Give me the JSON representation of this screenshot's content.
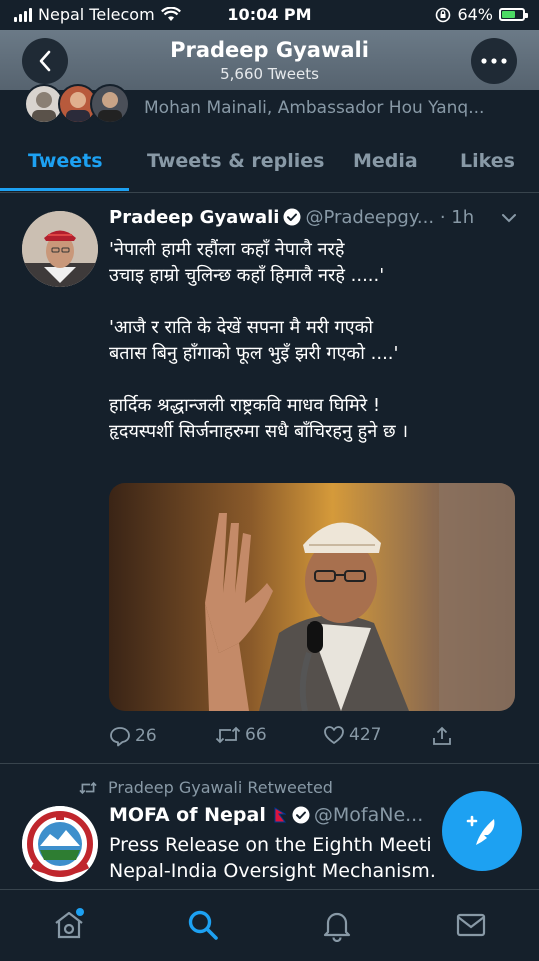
{
  "status_bar": {
    "carrier": "Nepal Telecom",
    "time": "10:04 PM",
    "battery": "64%",
    "battery_level": 0.64
  },
  "header": {
    "name": "Pradeep Gyawali",
    "tweet_count": "5,660 Tweets"
  },
  "followers_preview": {
    "text": "Mohan Mainali, Ambassador Hou Yanq..."
  },
  "tabs": [
    {
      "label": "Tweets",
      "active": true
    },
    {
      "label": "Tweets & replies",
      "active": false
    },
    {
      "label": "Media",
      "active": false
    },
    {
      "label": "Likes",
      "active": false
    }
  ],
  "tweet": {
    "name": "Pradeep Gyawali",
    "handle": "@Pradeepgy...",
    "time": "· 1h",
    "body": [
      "'नेपाली हामी रहौंला कहाँ नेपालै नरहे\nउचाइ हाम्रो चुलिन्छ कहाँ हिमालै नरहे .....'",
      "'आजै र राति के देखें सपना मै मरी गएको\nबतास बिनु हाँगाको फूल भुइँ झरी गएको ....'",
      "हार्दिक  श्रद्धान्जली राष्ट्रकवि माधव घिमिरे !\nहृदयस्पर्शी सिर्जनाहरुमा सधै बाँचिरहनु हुने छ ।"
    ],
    "replies": "26",
    "retweets": "66",
    "likes": "427"
  },
  "retweeted": {
    "label": "Pradeep Gyawali Retweeted",
    "name": "MOFA of Nepal",
    "handle": "@MofaNe...",
    "body": "Press Release on the Eighth Meeti\nNepal-India Oversight Mechanism."
  },
  "colors": {
    "accent": "#1da1f2",
    "background": "#15202b",
    "muted": "#8899a6",
    "divider": "#38444d"
  }
}
